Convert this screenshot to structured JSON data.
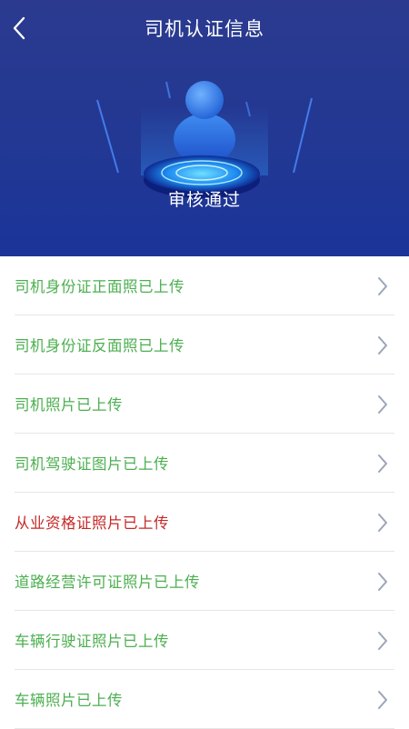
{
  "header": {
    "title": "司机认证信息",
    "status": "审核通过"
  },
  "colors": {
    "header_bg": "#223893",
    "uploaded": "#4caf50",
    "pending": "#c62828",
    "chevron": "#9aa5b8"
  },
  "items": [
    {
      "label": "司机身份证正面照已上传",
      "state": "uploaded"
    },
    {
      "label": "司机身份证反面照已上传",
      "state": "uploaded"
    },
    {
      "label": "司机照片已上传",
      "state": "uploaded"
    },
    {
      "label": "司机驾驶证图片已上传",
      "state": "uploaded"
    },
    {
      "label": "从业资格证照片已上传",
      "state": "pending"
    },
    {
      "label": "道路经营许可证照片已上传",
      "state": "uploaded"
    },
    {
      "label": "车辆行驶证照片已上传",
      "state": "uploaded"
    },
    {
      "label": "车辆照片已上传",
      "state": "uploaded"
    }
  ]
}
